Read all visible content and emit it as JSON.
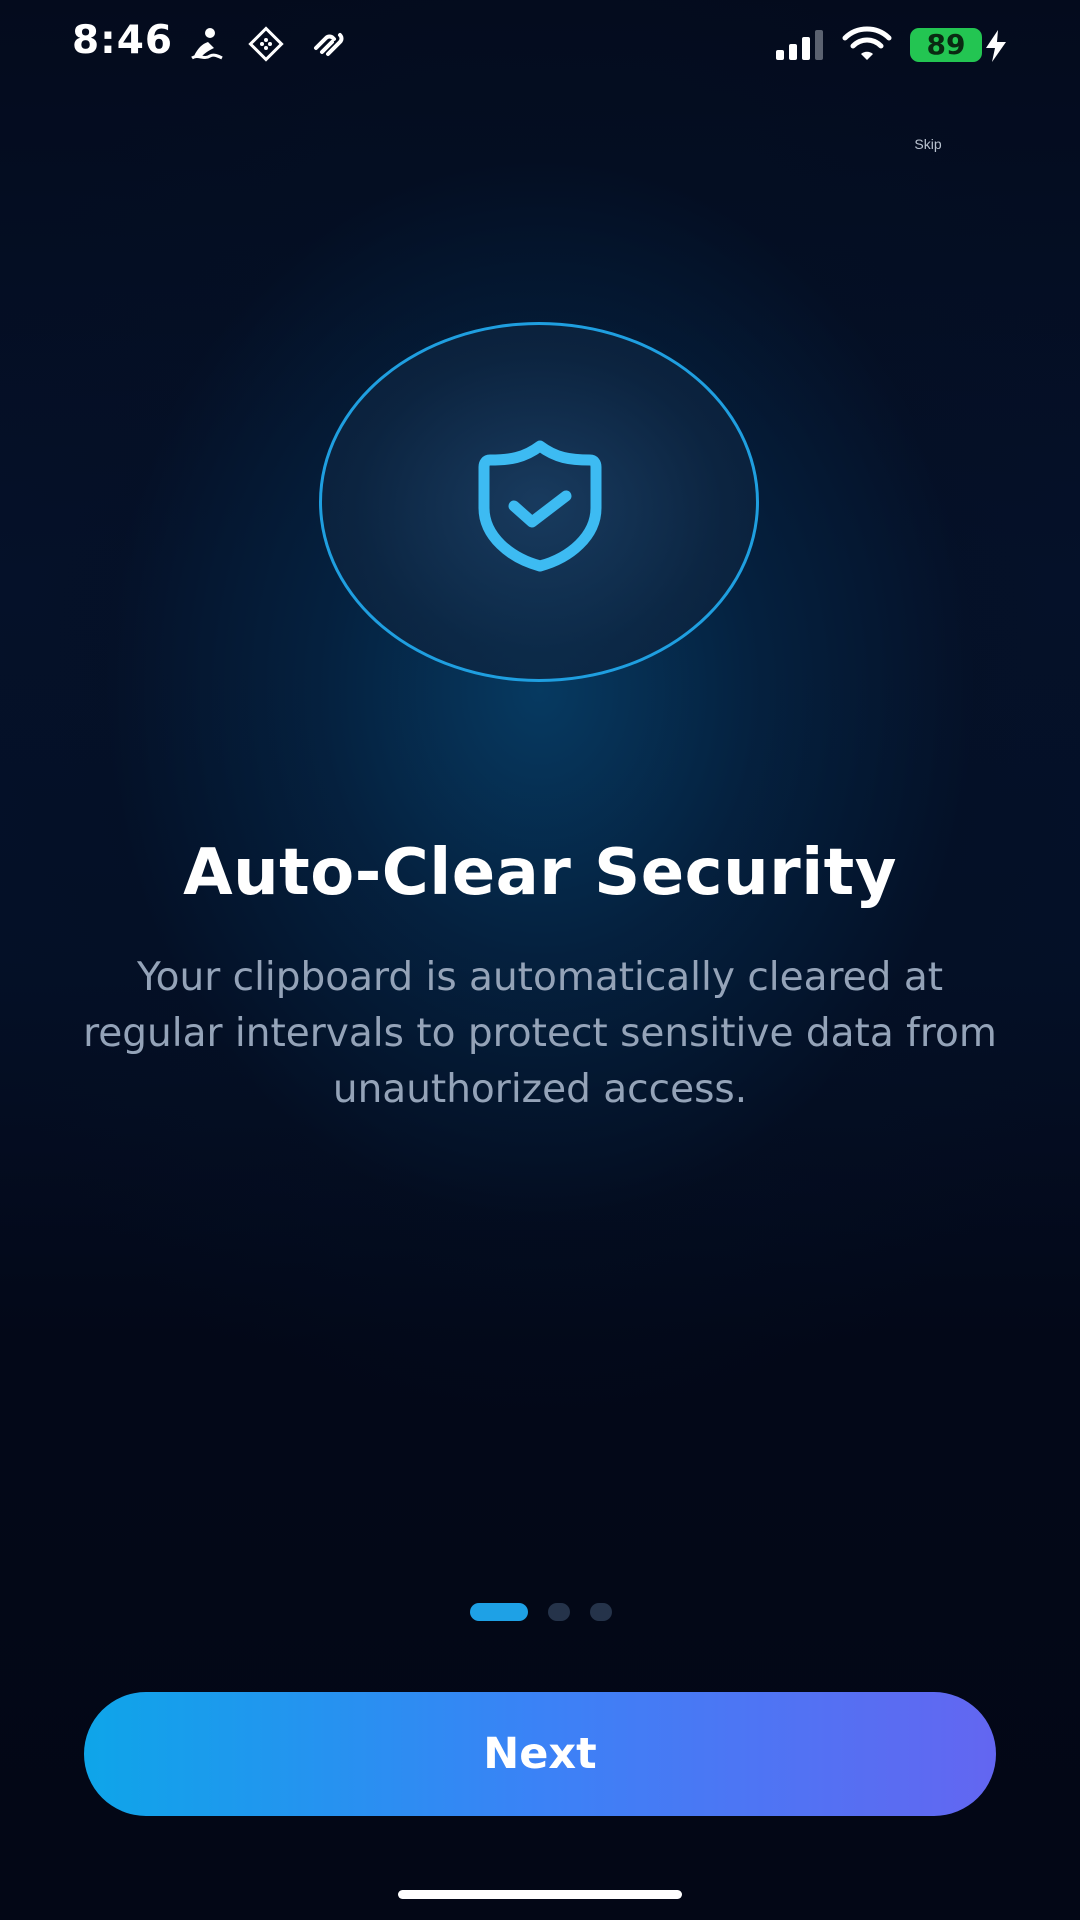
{
  "status_bar": {
    "time": "8:46",
    "battery_level": "89",
    "battery_charging": true,
    "left_icons": [
      "swimmer-icon",
      "grid-app-icon",
      "link-app-icon"
    ],
    "right_icons": [
      "cellular-signal-icon",
      "wifi-icon",
      "battery-icon",
      "charging-bolt-icon"
    ]
  },
  "header": {
    "skip_label": "Skip"
  },
  "hero": {
    "icon": "shield-check-icon"
  },
  "content": {
    "title": "Auto-Clear Security",
    "description": "Your clipboard is automatically cleared at regular intervals to protect sensitive data from unauthorized access."
  },
  "pager": {
    "total_pages": 3,
    "current_page": 1
  },
  "footer": {
    "next_label": "Next"
  },
  "colors": {
    "accent": "#0ea5e9",
    "accent_end": "#6366f1",
    "background": "#030716",
    "description_text": "#94a3b8",
    "battery": "#23c552"
  }
}
